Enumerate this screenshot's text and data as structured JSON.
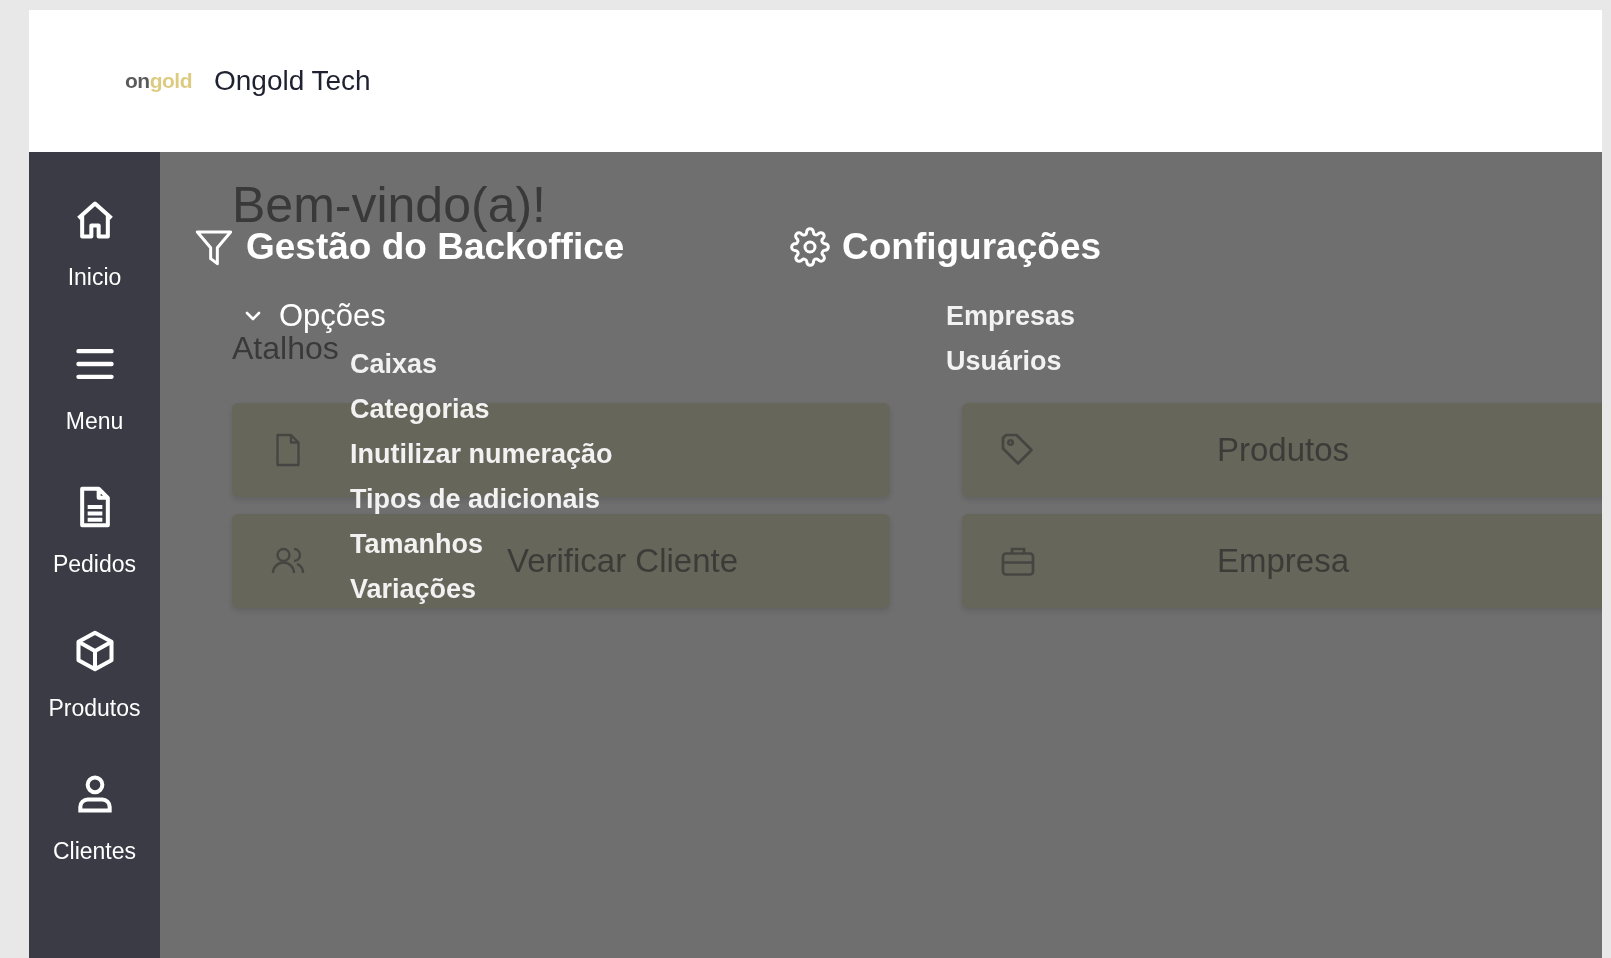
{
  "header": {
    "logo": "ongold",
    "company": "Ongold Tech"
  },
  "sidebar": {
    "items": [
      {
        "label": "Inicio",
        "kind": "home"
      },
      {
        "label": "Menu",
        "kind": "menu"
      },
      {
        "label": "Pedidos",
        "kind": "document"
      },
      {
        "label": "Produtos",
        "kind": "box"
      },
      {
        "label": "Clientes",
        "kind": "user"
      }
    ]
  },
  "home": {
    "welcome": "Bem-vindo(a)!",
    "shortcuts_title": "Atalhos",
    "shortcuts": [
      {
        "kind": "document"
      },
      {
        "label": "Produtos",
        "kind": "tag"
      },
      {
        "label": "Verificar Cliente",
        "kind": "users"
      },
      {
        "label": "Empresa",
        "kind": "briefcase"
      }
    ]
  },
  "menu_overlay": {
    "sections": [
      {
        "title": "Gestão do Backoffice",
        "kind": "filter",
        "groups": [
          {
            "label": "Opções",
            "expanded": true,
            "items": [
              "Caixas",
              "Categorias",
              "Inutilizar numeração",
              "Tipos de adicionais",
              "Tamanhos",
              "Variações"
            ]
          }
        ]
      },
      {
        "title": "Configurações",
        "kind": "gear",
        "items": [
          "Empresas",
          "Usuários"
        ]
      }
    ]
  }
}
